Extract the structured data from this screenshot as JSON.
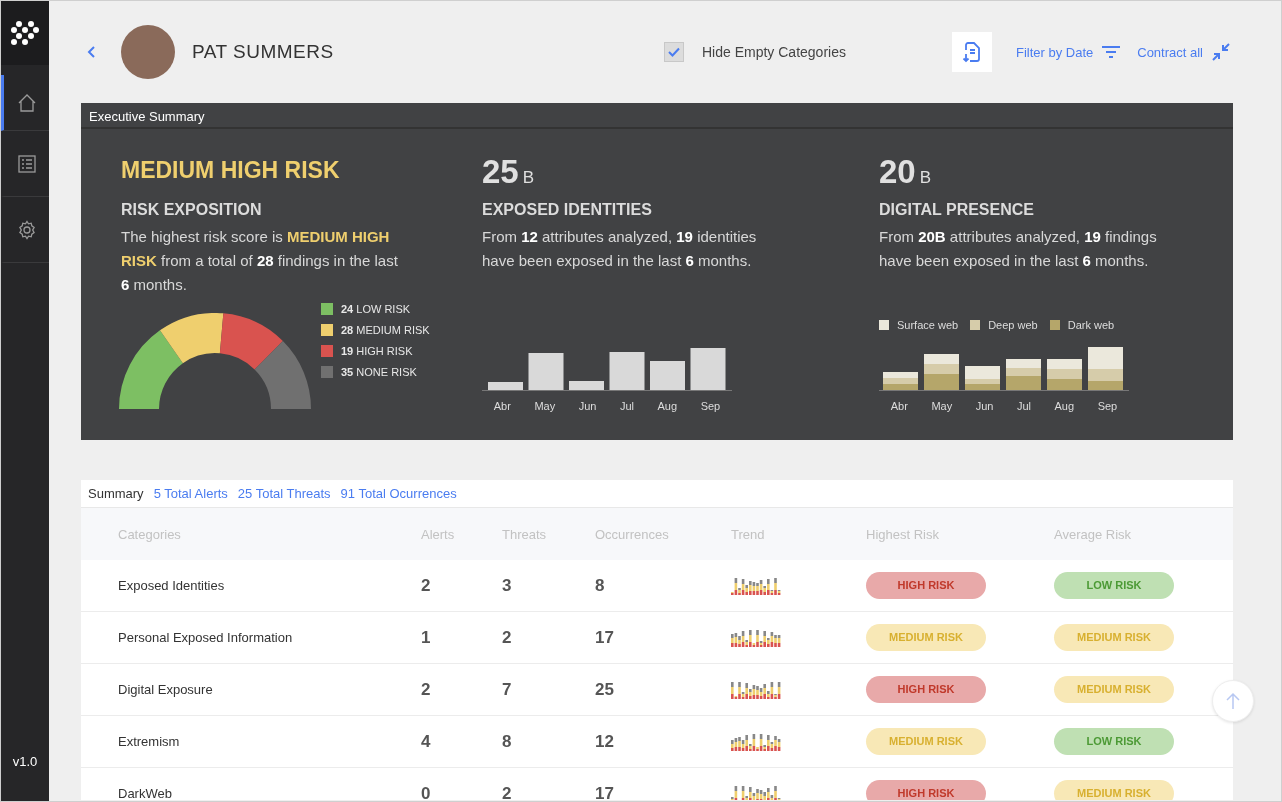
{
  "sidebar": {
    "items": [
      {
        "selected": true
      },
      {
        "selected": false
      },
      {
        "selected": false
      }
    ],
    "version": "v1.0"
  },
  "header": {
    "name": "PAT SUMMERS",
    "hide_empty": {
      "label": "Hide Empty Categories",
      "checked": true
    },
    "filter_label": "Filter by Date",
    "contract_label": "Contract all"
  },
  "executive_summary": {
    "title": "Executive Summary",
    "risk": {
      "level_title": "MEDIUM HIGH RISK",
      "heading": "RISK EXPOSITION",
      "text": [
        {
          "text": "The highest risk score is ",
          "kind": "plain"
        },
        {
          "text": "MEDIUM HIGH RISK",
          "kind": "highlight"
        },
        {
          "text": " from a total of ",
          "kind": "plain"
        },
        {
          "text": "28",
          "kind": "bold"
        },
        {
          "text": " findings in the last ",
          "kind": "plain"
        },
        {
          "text": "6",
          "kind": "bold"
        },
        {
          "text": " months.",
          "kind": "plain"
        }
      ],
      "legend": [
        {
          "count": "24",
          "label": "LOW RISK",
          "color": "#7dbf63"
        },
        {
          "count": "28",
          "label": "MEDIUM RISK",
          "color": "#efcf6e"
        },
        {
          "count": "19",
          "label": "HIGH RISK",
          "color": "#d9534f"
        },
        {
          "count": "35",
          "label": "NONE RISK",
          "color": "#707070"
        }
      ]
    },
    "identities": {
      "value": "25",
      "unit": "B",
      "heading": "EXPOSED IDENTITIES",
      "text": [
        {
          "text": "From ",
          "kind": "plain"
        },
        {
          "text": "12",
          "kind": "bold"
        },
        {
          "text": " attributes analyzed, ",
          "kind": "plain"
        },
        {
          "text": "19",
          "kind": "bold"
        },
        {
          "text": " identities have been exposed in the last ",
          "kind": "plain"
        },
        {
          "text": "6",
          "kind": "bold"
        },
        {
          "text": " months.",
          "kind": "plain"
        }
      ],
      "months": [
        "Abr",
        "May",
        "Jun",
        "Jul",
        "Aug",
        "Sep"
      ]
    },
    "presence": {
      "value": "20",
      "unit": "B",
      "heading": "DIGITAL PRESENCE",
      "text": [
        {
          "text": "From ",
          "kind": "plain"
        },
        {
          "text": "20B",
          "kind": "bold"
        },
        {
          "text": " attributes analyzed, ",
          "kind": "plain"
        },
        {
          "text": "19",
          "kind": "bold"
        },
        {
          "text": " findings have been exposed in the last ",
          "kind": "plain"
        },
        {
          "text": "6",
          "kind": "bold"
        },
        {
          "text": " months.",
          "kind": "plain"
        }
      ],
      "legend": [
        {
          "label": "Surface web",
          "color": "#ebe8dc"
        },
        {
          "label": "Deep web",
          "color": "#d6ccaa"
        },
        {
          "label": "Dark web",
          "color": "#b5a66a"
        }
      ],
      "months": [
        "Abr",
        "May",
        "Jun",
        "Jul",
        "Aug",
        "Sep"
      ]
    }
  },
  "summary": {
    "tabs": [
      {
        "label": "Summary",
        "selected": true
      },
      {
        "label": "5 Total Alerts",
        "selected": false
      },
      {
        "label": "25 Total Threats",
        "selected": false
      },
      {
        "label": "91 Total Ocurrences",
        "selected": false
      }
    ],
    "columns": [
      "Categories",
      "Alerts",
      "Threats",
      "Occurrences",
      "Trend",
      "Highest Risk",
      "Average Risk"
    ],
    "rows": [
      {
        "category": "Exposed Identities",
        "alerts": "2",
        "threats": "3",
        "occurrences": "8",
        "highest": {
          "label": "HIGH RISK",
          "kind": "high"
        },
        "average": {
          "label": "LOW RISK",
          "kind": "low"
        }
      },
      {
        "category": "Personal Exposed Information",
        "alerts": "1",
        "threats": "2",
        "occurrences": "17",
        "highest": {
          "label": "MEDIUM RISK",
          "kind": "medium"
        },
        "average": {
          "label": "MEDIUM RISK",
          "kind": "medium"
        }
      },
      {
        "category": "Digital Exposure",
        "alerts": "2",
        "threats": "7",
        "occurrences": "25",
        "highest": {
          "label": "HIGH RISK",
          "kind": "high"
        },
        "average": {
          "label": "MEDIUM RISK",
          "kind": "medium"
        }
      },
      {
        "category": "Extremism",
        "alerts": "4",
        "threats": "8",
        "occurrences": "12",
        "highest": {
          "label": "MEDIUM RISK",
          "kind": "medium"
        },
        "average": {
          "label": "LOW RISK",
          "kind": "low"
        }
      },
      {
        "category": "DarkWeb",
        "alerts": "0",
        "threats": "2",
        "occurrences": "17",
        "highest": {
          "label": "HIGH RISK",
          "kind": "high"
        },
        "average": {
          "label": "MEDIUM RISK",
          "kind": "medium"
        }
      }
    ]
  }
}
